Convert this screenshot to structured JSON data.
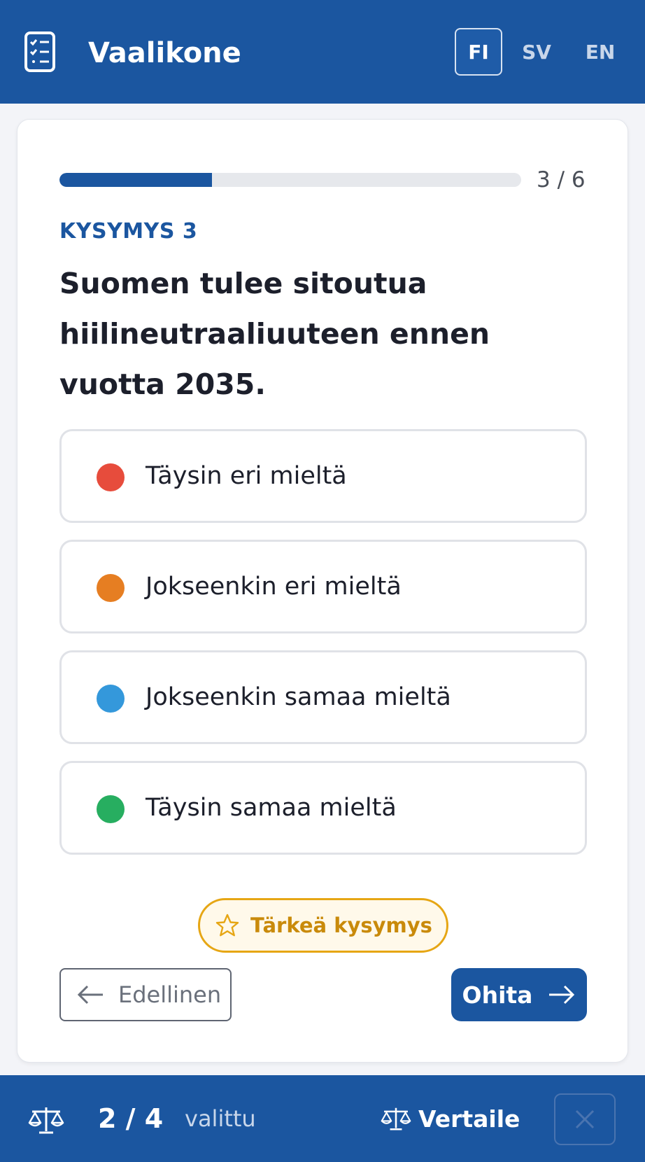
{
  "header": {
    "title": "Vaalikone",
    "logo_icon": "checklist-icon",
    "languages": [
      {
        "code": "FI",
        "active": true
      },
      {
        "code": "SV",
        "active": false
      },
      {
        "code": "EN",
        "active": false
      }
    ]
  },
  "progress": {
    "current": 3,
    "total": 6,
    "fraction": 0.33,
    "label": "3 / 6"
  },
  "question": {
    "label": "KYSYMYS 3",
    "text": "Suomen tulee sitoutua hiilineutraaliuuteen ennen vuotta 2035."
  },
  "options": [
    {
      "label": "Täysin eri mieltä",
      "color": "#e74c3c"
    },
    {
      "label": "Jokseenkin eri mieltä",
      "color": "#e67e22"
    },
    {
      "label": "Jokseenkin samaa mieltä",
      "color": "#3498db"
    },
    {
      "label": "Täysin samaa mieltä",
      "color": "#27ae60"
    }
  ],
  "actions": {
    "important_label": "Tärkeä kysymys",
    "important_icon": "star-icon",
    "prev_label": "Edellinen",
    "prev_icon": "arrow-left-icon",
    "skip_label": "Ohita",
    "skip_icon": "arrow-right-icon"
  },
  "footer": {
    "count": "2 / 4",
    "status": "valittu",
    "compare_label": "Vertaile",
    "compare_icon": "scale-icon",
    "clear_icon": "close-icon"
  },
  "colors": {
    "primary": "#1b56a0",
    "accent_gold": "#e6a614"
  }
}
